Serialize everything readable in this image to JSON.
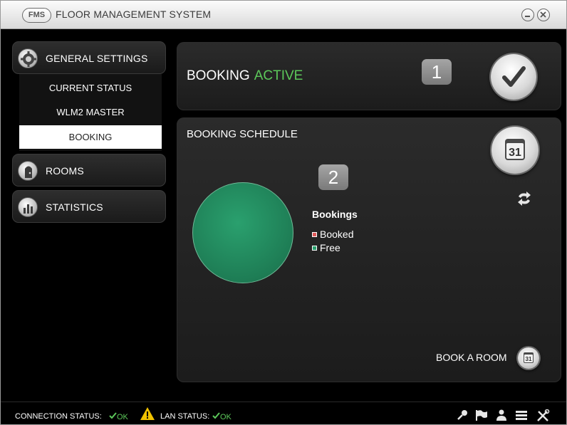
{
  "titlebar": {
    "badge": "FMS",
    "title": "FLOOR MANAGEMENT SYSTEM"
  },
  "sidebar": {
    "general_settings": "GENERAL SETTINGS",
    "sub_items": [
      "CURRENT STATUS",
      "WLM2 MASTER",
      "BOOKING"
    ],
    "selected": "BOOKING",
    "rooms": "ROOMS",
    "statistics": "STATISTICS"
  },
  "booking_panel": {
    "label": "BOOKING",
    "status": "ACTIVE",
    "badge_number": "1"
  },
  "schedule_panel": {
    "title": "BOOKING SCHEDULE",
    "badge_number": "2",
    "calendar_day": "31",
    "legend_title": "Bookings",
    "legend": [
      "Booked",
      "Free"
    ],
    "book_room_label": "BOOK A ROOM",
    "book_room_icon_day": "31"
  },
  "chart_data": {
    "type": "pie",
    "categories": [
      "Booked",
      "Free"
    ],
    "values": [
      0,
      100
    ],
    "colors": [
      "#e05a5a",
      "#1f8a5c"
    ]
  },
  "statusbar": {
    "connection_label": "CONNECTION STATUS:",
    "connection_value": "OK",
    "lan_label": "LAN STATUS:",
    "lan_value": "OK"
  },
  "colors": {
    "accent_green": "#5cc85a",
    "pie_green": "#1f8a5c",
    "background": "#000000"
  }
}
